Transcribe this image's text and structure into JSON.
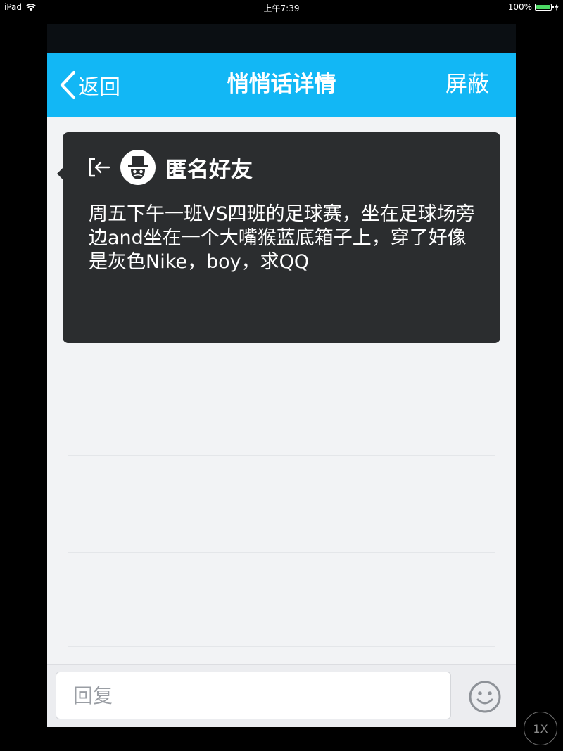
{
  "device_status": {
    "device": "iPad",
    "time": "上午7:39",
    "battery": "100%",
    "battery_level": 1.0,
    "battery_color": "#4cd964"
  },
  "navbar": {
    "back_label": "返回",
    "title": "悄悄话详情",
    "right_action": "屏蔽",
    "color": "#12b7f5"
  },
  "card": {
    "sender_name": "匿名好友",
    "message": "周五下午一班VS四班的足球赛，坐在足球场旁边and坐在一个大嘴猴蓝底箱子上，穿了好像是灰色Nike，boy，求QQ",
    "color": "#2b2d2f",
    "icons": [
      "exit-icon",
      "anonymous-avatar-icon"
    ]
  },
  "reply": {
    "placeholder": "回复",
    "emoji_icon": "smiley-icon"
  },
  "zoom_button": "1X"
}
